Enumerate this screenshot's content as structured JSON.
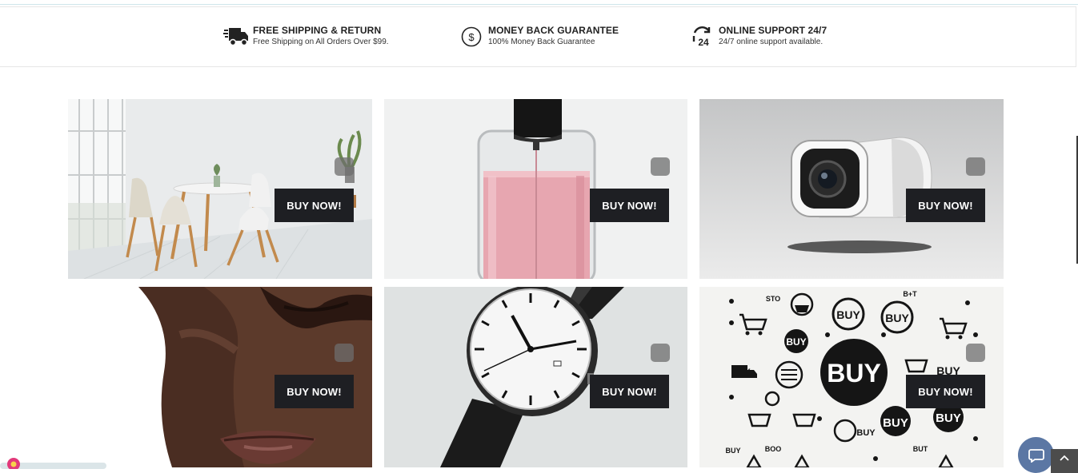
{
  "features": [
    {
      "icon": "truck-icon",
      "title": "FREE SHIPPING & RETURN",
      "subtitle": "Free Shipping on All Orders Over $99."
    },
    {
      "icon": "dollar-circle-icon",
      "title": "MONEY BACK GUARANTEE",
      "subtitle": "100% Money Back Guarantee"
    },
    {
      "icon": "support-24-icon",
      "title": "ONLINE SUPPORT 24/7",
      "subtitle": "24/7 online support available."
    }
  ],
  "products": [
    {
      "image": "dining-room-chairs",
      "button": "BUY NOW!"
    },
    {
      "image": "pink-perfume-bottle",
      "button": "BUY NOW!"
    },
    {
      "image": "security-camera",
      "button": "BUY NOW!"
    },
    {
      "image": "woman-face-skincare",
      "button": "BUY NOW!"
    },
    {
      "image": "black-wristwatch",
      "button": "BUY NOW!"
    },
    {
      "image": "buy-icons-collage",
      "button": "BUY NOW!",
      "collage_text": {
        "big": "BUY",
        "small": "BUY",
        "b1": "BUY",
        "sto": "STO",
        "boo": "BOO",
        "but": "BUT",
        "bt": "B+T"
      }
    }
  ],
  "colors": {
    "button_bg": "#1e1f23",
    "chat_bg": "#5b77a4"
  }
}
